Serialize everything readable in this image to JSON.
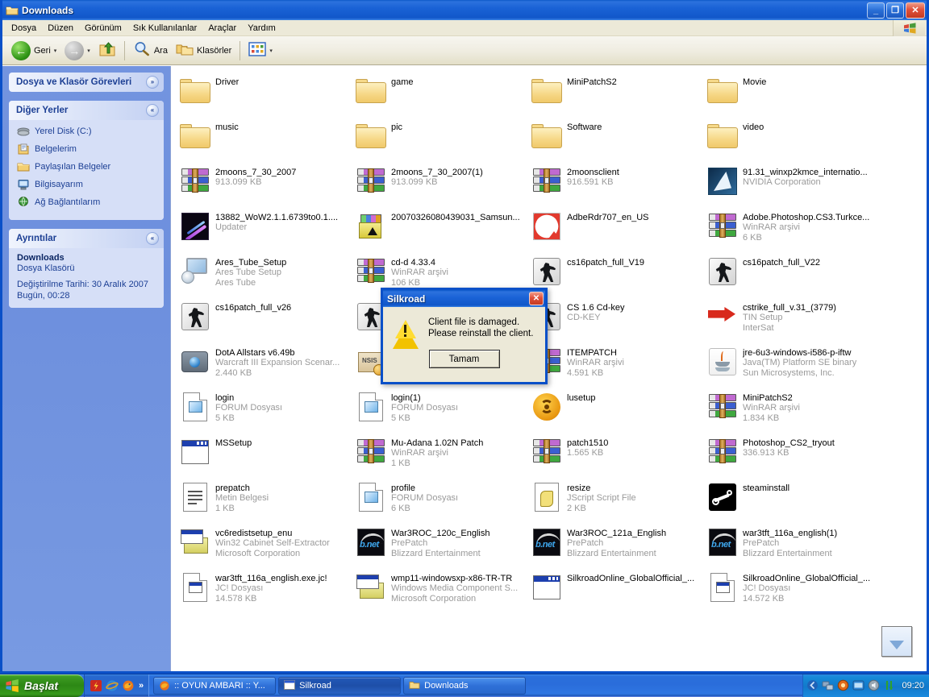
{
  "window": {
    "title": "Downloads",
    "icon": "folder-icon",
    "minimize_label": "_",
    "maximize_label": "❐",
    "close_label": "✕"
  },
  "menubar": {
    "items": [
      {
        "label": "Dosya"
      },
      {
        "label": "Düzen"
      },
      {
        "label": "Görünüm"
      },
      {
        "label": "Sık Kullanılanlar"
      },
      {
        "label": "Araçlar"
      },
      {
        "label": "Yardım"
      }
    ]
  },
  "toolbar": {
    "back_label": "Geri",
    "forward_label": "",
    "up_label": "",
    "search_label": "Ara",
    "folders_label": "Klasörler",
    "views_label": "",
    "caret": "▾"
  },
  "sidebar": {
    "tasks_panel": {
      "title": "Dosya ve Klasör Görevleri",
      "chevron": "»"
    },
    "places_panel": {
      "title": "Diğer Yerler",
      "chevron": "«",
      "items": [
        {
          "label": "Yerel Disk (C:)",
          "icon": "hard-disk-icon"
        },
        {
          "label": "Belgelerim",
          "icon": "my-documents-icon"
        },
        {
          "label": "Paylaşılan Belgeler",
          "icon": "shared-documents-icon"
        },
        {
          "label": "Bilgisayarım",
          "icon": "my-computer-icon"
        },
        {
          "label": "Ağ Bağlantılarım",
          "icon": "network-places-icon"
        }
      ]
    },
    "details_panel": {
      "title": "Ayrıntılar",
      "chevron": "«",
      "name": "Downloads",
      "type": "Dosya Klasörü",
      "modified": "Değiştirilme Tarihi: 30 Aralık 2007 Bugün, 00:28"
    }
  },
  "files": [
    {
      "name": "Driver",
      "sub1": "",
      "sub2": "",
      "icon": "folder-icon"
    },
    {
      "name": "game",
      "sub1": "",
      "sub2": "",
      "icon": "folder-icon"
    },
    {
      "name": "MiniPatchS2",
      "sub1": "",
      "sub2": "",
      "icon": "folder-icon"
    },
    {
      "name": "Movie",
      "sub1": "",
      "sub2": "",
      "icon": "folder-icon"
    },
    {
      "name": "music",
      "sub1": "",
      "sub2": "",
      "icon": "folder-icon"
    },
    {
      "name": "pic",
      "sub1": "",
      "sub2": "",
      "icon": "folder-icon"
    },
    {
      "name": "Software",
      "sub1": "",
      "sub2": "",
      "icon": "folder-icon"
    },
    {
      "name": "video",
      "sub1": "",
      "sub2": "",
      "icon": "folder-icon"
    },
    {
      "name": "2moons_7_30_2007",
      "sub1": "913.099 KB",
      "sub2": "",
      "icon": "winrar-archive-icon"
    },
    {
      "name": "2moons_7_30_2007(1)",
      "sub1": "913.099 KB",
      "sub2": "",
      "icon": "winrar-archive-icon"
    },
    {
      "name": "2moonsclient",
      "sub1": "916.591 KB",
      "sub2": "",
      "icon": "winrar-archive-icon"
    },
    {
      "name": "91.31_winxp2kmce_internatio...",
      "sub1": "NVIDIA Corporation",
      "sub2": "",
      "icon": "nvidia-installer-icon"
    },
    {
      "name": "13882_WoW2.1.1.6739to0.1....",
      "sub1": "Updater",
      "sub2": "",
      "icon": "wow-updater-icon"
    },
    {
      "name": "20070326080439031_Samsun...",
      "sub1": "",
      "sub2": "",
      "icon": "samsung-installer-icon"
    },
    {
      "name": "AdbeRdr707_en_US",
      "sub1": "",
      "sub2": "",
      "icon": "adobe-reader-icon"
    },
    {
      "name": "Adobe.Photoshop.CS3.Turkce...",
      "sub1": "WinRAR arşivi",
      "sub2": "6 KB",
      "icon": "winrar-archive-icon"
    },
    {
      "name": "Ares_Tube_Setup",
      "sub1": "Ares Tube Setup",
      "sub2": "Ares Tube",
      "icon": "ares-tube-icon"
    },
    {
      "name": "cd-d 4.33.4",
      "sub1": "WinRAR arşivi",
      "sub2": "106 KB",
      "icon": "winrar-archive-icon"
    },
    {
      "name": "cs16patch_full_V19",
      "sub1": "",
      "sub2": "",
      "icon": "counter-strike-icon"
    },
    {
      "name": "cs16patch_full_V22",
      "sub1": "",
      "sub2": "",
      "icon": "counter-strike-icon"
    },
    {
      "name": "cs16patch_full_v26",
      "sub1": "",
      "sub2": "",
      "icon": "counter-strike-icon"
    },
    {
      "name": "",
      "sub1": "",
      "sub2": "",
      "icon": "counter-strike-icon"
    },
    {
      "name": "CS 1.6 Cd-key",
      "sub1": "CD-KEY",
      "sub2": "",
      "icon": "counter-strike-icon"
    },
    {
      "name": "cstrike_full_v.31_(3779)",
      "sub1": "TIN Setup",
      "sub2": "InterSat",
      "icon": "tin-setup-icon"
    },
    {
      "name": "DotA Allstars v6.49b",
      "sub1": "Warcraft III Expansion Scenar...",
      "sub2": "2.440 KB",
      "icon": "warcraft-map-icon"
    },
    {
      "name": "",
      "sub1": "",
      "sub2": "",
      "icon": "nsis-installer-icon"
    },
    {
      "name": "ITEMPATCH",
      "sub1": "WinRAR arşivi",
      "sub2": "4.591 KB",
      "icon": "winrar-archive-icon"
    },
    {
      "name": "jre-6u3-windows-i586-p-iftw",
      "sub1": "Java(TM) Platform SE binary",
      "sub2": "Sun Microsystems, Inc.",
      "icon": "java-icon"
    },
    {
      "name": "login",
      "sub1": "FORUM Dosyası",
      "sub2": "5 KB",
      "icon": "forum-file-icon"
    },
    {
      "name": "login(1)",
      "sub1": "FORUM Dosyası",
      "sub2": "5 KB",
      "icon": "forum-file-icon"
    },
    {
      "name": "lusetup",
      "sub1": "",
      "sub2": "",
      "icon": "live-update-icon"
    },
    {
      "name": "MiniPatchS2",
      "sub1": "WinRAR arşivi",
      "sub2": "1.834 KB",
      "icon": "winrar-archive-icon"
    },
    {
      "name": "MSSetup",
      "sub1": "",
      "sub2": "",
      "icon": "application-window-icon"
    },
    {
      "name": "Mu-Adana 1.02N Patch",
      "sub1": "WinRAR arşivi",
      "sub2": "1 KB",
      "icon": "winrar-archive-icon"
    },
    {
      "name": "patch1510",
      "sub1": "1.565 KB",
      "sub2": "",
      "icon": "winrar-archive-icon"
    },
    {
      "name": "Photoshop_CS2_tryout",
      "sub1": "336.913 KB",
      "sub2": "",
      "icon": "winrar-archive-icon"
    },
    {
      "name": "prepatch",
      "sub1": "Metin Belgesi",
      "sub2": "1 KB",
      "icon": "text-document-icon"
    },
    {
      "name": "profile",
      "sub1": "FORUM Dosyası",
      "sub2": "6 KB",
      "icon": "forum-file-icon"
    },
    {
      "name": "resize",
      "sub1": "JScript Script File",
      "sub2": "2 KB",
      "icon": "jscript-file-icon"
    },
    {
      "name": "steaminstall",
      "sub1": "",
      "sub2": "",
      "icon": "steam-icon"
    },
    {
      "name": "vc6redistsetup_enu",
      "sub1": "Win32 Cabinet Self-Extractor",
      "sub2": "Microsoft Corporation",
      "icon": "cabinet-extractor-icon"
    },
    {
      "name": "War3ROC_120c_English",
      "sub1": "PrePatch",
      "sub2": "Blizzard Entertainment",
      "icon": "battlenet-icon"
    },
    {
      "name": "War3ROC_121a_English",
      "sub1": "PrePatch",
      "sub2": "Blizzard Entertainment",
      "icon": "battlenet-icon"
    },
    {
      "name": "war3tft_116a_english(1)",
      "sub1": "PrePatch",
      "sub2": "Blizzard Entertainment",
      "icon": "battlenet-icon"
    },
    {
      "name": "war3tft_116a_english.exe.jc!",
      "sub1": "JC! Dosyası",
      "sub2": "14.578 KB",
      "icon": "jc-file-icon"
    },
    {
      "name": "wmp11-windowsxp-x86-TR-TR",
      "sub1": "Windows Media Component S...",
      "sub2": "Microsoft Corporation",
      "icon": "cabinet-extractor-icon"
    },
    {
      "name": "SilkroadOnline_GlobalOfficial_...",
      "sub1": "",
      "sub2": "",
      "icon": "application-window-icon"
    },
    {
      "name": "SilkroadOnline_GlobalOfficial_...",
      "sub1": "JC! Dosyası",
      "sub2": "14.572 KB",
      "icon": "jc-file-icon"
    }
  ],
  "dialog": {
    "title": "Silkroad",
    "close_label": "✕",
    "message_line1": "Client file is damaged.",
    "message_line2": "Please reinstall the client.",
    "ok_label": "Tamam",
    "icon": "warning-icon"
  },
  "download_button": {
    "icon": "download-arrow-icon"
  },
  "taskbar": {
    "start_label": "Başlat",
    "quicklaunch": [
      {
        "icon": "winamp-icon"
      },
      {
        "icon": "internet-explorer-icon"
      },
      {
        "icon": "firefox-icon"
      }
    ],
    "quicklaunch_more": "»",
    "tasks": [
      {
        "label": ":: OYUN AMBARI :: Y...",
        "icon": "firefox-icon",
        "active": false
      },
      {
        "label": "Silkroad",
        "icon": "application-window-icon",
        "active": true
      },
      {
        "label": "Downloads",
        "icon": "folder-icon",
        "active": false
      }
    ],
    "tray": [
      {
        "icon": "show-hidden-icons-icon"
      },
      {
        "icon": "network-icon"
      },
      {
        "icon": "antivirus-icon"
      },
      {
        "icon": "messenger-icon"
      },
      {
        "icon": "volume-icon"
      },
      {
        "icon": "network-activity-icon"
      }
    ],
    "clock": "09:20"
  },
  "colors": {
    "titlebar_blue": "#1a62d6",
    "sidebar_blue": "#7394df",
    "panel_body": "#d6dff7",
    "panel_heading_text": "#1c3f94",
    "taskbar_blue": "#2a6fdb",
    "start_green": "#2d8815",
    "toolbar_beige": "#ece9d8",
    "file_sub_grey": "#9a9a9a"
  }
}
